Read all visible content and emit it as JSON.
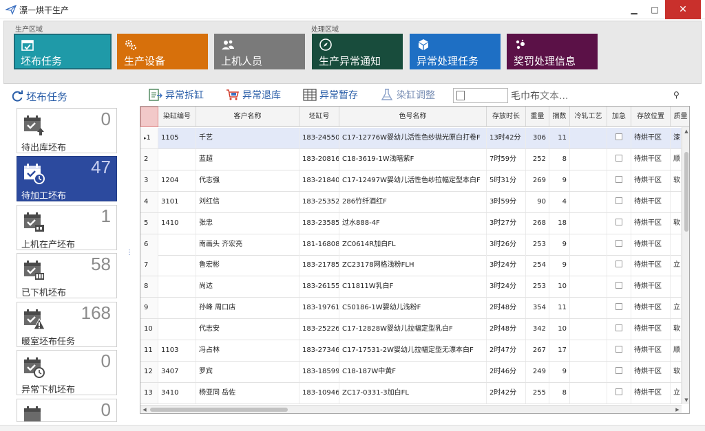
{
  "window": {
    "title": "漂一烘干生产"
  },
  "ribbon": {
    "groups": [
      {
        "label": "生产区域"
      },
      {
        "label": "处理区域"
      }
    ],
    "tiles": [
      {
        "label": "坯布任务",
        "icon": "calendar-check-icon",
        "color": "#1f9aa8"
      },
      {
        "label": "生产设备",
        "icon": "gears-icon",
        "color": "#d7700b"
      },
      {
        "label": "上机人员",
        "icon": "users-icon",
        "color": "#7a7a7a"
      },
      {
        "label": "生产异常通知",
        "icon": "compass-icon",
        "color": "#184c3c"
      },
      {
        "label": "异常处理任务",
        "icon": "cube-icon",
        "color": "#1e6fc4"
      },
      {
        "label": "奖罚处理信息",
        "icon": "dots-icon",
        "color": "#5b1147"
      }
    ]
  },
  "left_panel": {
    "title": "坯布任务",
    "cards": [
      {
        "label": "待出库坯布",
        "count": "0",
        "icon": "calendar-upload-icon"
      },
      {
        "label": "待加工坯布",
        "count": "47",
        "icon": "calendar-clock-icon"
      },
      {
        "label": "上机在产坯布",
        "count": "1",
        "icon": "calendar-machine-icon"
      },
      {
        "label": "已下机坯布",
        "count": "58",
        "icon": "calendar-grid-icon"
      },
      {
        "label": "暖室坯布任务",
        "count": "168",
        "icon": "calendar-warning-icon"
      },
      {
        "label": "异常下机坯布",
        "count": "0",
        "icon": "calendar-time-icon"
      },
      {
        "label": "",
        "count": "0",
        "icon": "calendar-icon"
      }
    ]
  },
  "toolbar": {
    "buttons": [
      {
        "label": "异常拆缸",
        "icon": "split-icon"
      },
      {
        "label": "异常退库",
        "icon": "cart-return-icon"
      },
      {
        "label": "异常暂存",
        "icon": "table-icon"
      },
      {
        "label": "染缸调整",
        "icon": "flask-icon"
      }
    ],
    "search_label": "毛巾布",
    "search_placeholder": "文本..."
  },
  "grid": {
    "columns": [
      "",
      "染缸编号",
      "客户名称",
      "坯缸号",
      "色号名称",
      "存放时长",
      "重量",
      "捆数",
      "冷轧工艺",
      "加急",
      "存放位置",
      "质量"
    ],
    "rows": [
      {
        "rn": "1",
        "marker": "▸",
        "dye": "1105",
        "customer": "千艺",
        "batch": "183-24550",
        "color": "C17-12776W婴幼儿活性色纱抛光原白打卷F",
        "duration": "13时42分",
        "weight": "306",
        "bundles": "11",
        "cold": "",
        "location": "待烘干区",
        "quality": "漆"
      },
      {
        "rn": "2",
        "marker": "",
        "dye": "",
        "customer": "蓝超",
        "batch": "183-20816",
        "color": "C18-3619-1W浅暗紫F",
        "duration": "7时59分",
        "weight": "252",
        "bundles": "8",
        "cold": "",
        "location": "待烘干区",
        "quality": "顺"
      },
      {
        "rn": "3",
        "marker": "",
        "dye": "1204",
        "customer": "代志强",
        "batch": "183-21840",
        "color": "C17-12497W婴幼儿活性色纱拉幅定型本白F",
        "duration": "5时31分",
        "weight": "269",
        "bundles": "9",
        "cold": "",
        "location": "待烘干区",
        "quality": "软"
      },
      {
        "rn": "4",
        "marker": "",
        "dye": "3101",
        "customer": "刘红信",
        "batch": "183-25352",
        "color": "286竹纤酒红F",
        "duration": "3时59分",
        "weight": "90",
        "bundles": "4",
        "cold": "",
        "location": "待烘干区",
        "quality": ""
      },
      {
        "rn": "5",
        "marker": "",
        "dye": "1410",
        "customer": "张忠",
        "batch": "183-23585",
        "color": "过水888-4F",
        "duration": "3时27分",
        "weight": "268",
        "bundles": "18",
        "cold": "",
        "location": "待烘干区",
        "quality": "软"
      },
      {
        "rn": "6",
        "marker": "",
        "dye": "",
        "customer": "南画头 齐宏亮",
        "batch": "181-16808",
        "color": "ZC0614R加白FL",
        "duration": "3时26分",
        "weight": "253",
        "bundles": "9",
        "cold": "",
        "location": "待烘干区",
        "quality": ""
      },
      {
        "rn": "7",
        "marker": "",
        "dye": "",
        "customer": "鲁宏彬",
        "batch": "183-21785",
        "color": "ZC23178网格浅粉FLH",
        "duration": "3时24分",
        "weight": "254",
        "bundles": "9",
        "cold": "",
        "location": "待烘干区",
        "quality": "立"
      },
      {
        "rn": "8",
        "marker": "",
        "dye": "",
        "customer": "尚达",
        "batch": "183-26155",
        "color": "C11811W乳白F",
        "duration": "3时24分",
        "weight": "253",
        "bundles": "10",
        "cold": "",
        "location": "待烘干区",
        "quality": ""
      },
      {
        "rn": "9",
        "marker": "",
        "dye": "",
        "customer": "孙峰 周口店",
        "batch": "183-19761",
        "color": "C50186-1W婴幼儿浅粉F",
        "duration": "2时48分",
        "weight": "354",
        "bundles": "11",
        "cold": "",
        "location": "待烘干区",
        "quality": "立"
      },
      {
        "rn": "10",
        "marker": "",
        "dye": "",
        "customer": "代志安",
        "batch": "183-25226",
        "color": "C17-12828W婴幼儿拉幅定型乳白F",
        "duration": "2时48分",
        "weight": "342",
        "bundles": "10",
        "cold": "",
        "location": "待烘干区",
        "quality": "软"
      },
      {
        "rn": "11",
        "marker": "",
        "dye": "1103",
        "customer": "冯占林",
        "batch": "183-27346",
        "color": "C17-17531-2W婴幼儿拉幅定型无漂本白F",
        "duration": "2时47分",
        "weight": "267",
        "bundles": "17",
        "cold": "",
        "location": "待烘干区",
        "quality": "顺"
      },
      {
        "rn": "12",
        "marker": "",
        "dye": "3407",
        "customer": "罗宾",
        "batch": "183-18599",
        "color": "C18-187W中黄F",
        "duration": "2时46分",
        "weight": "249",
        "bundles": "9",
        "cold": "",
        "location": "待烘干区",
        "quality": "软"
      },
      {
        "rn": "13",
        "marker": "",
        "dye": "3410",
        "customer": "杨亚同 岳佐",
        "batch": "183-10946",
        "color": "ZC17-0331-3加白FL",
        "duration": "2时42分",
        "weight": "255",
        "bundles": "8",
        "cold": "",
        "location": "待烘干区",
        "quality": "立"
      }
    ]
  }
}
